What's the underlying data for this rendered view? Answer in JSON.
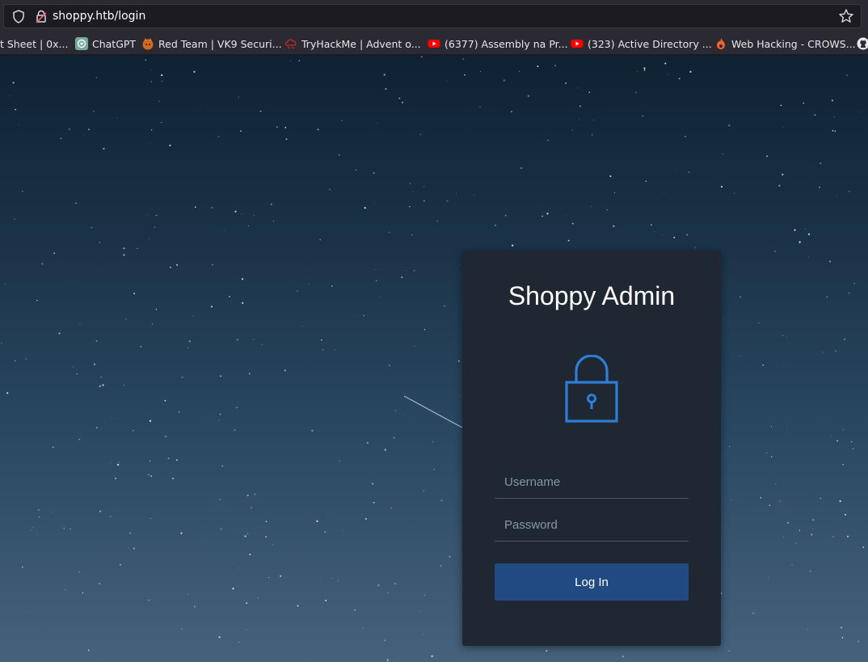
{
  "browser": {
    "url": "shoppy.htb/login",
    "bookmarks": [
      {
        "label": "t Sheet | 0x...",
        "icon": "none"
      },
      {
        "label": "ChatGPT",
        "icon": "chatgpt-icon"
      },
      {
        "label": "Red Team | VK9 Securi...",
        "icon": "vk9-icon"
      },
      {
        "label": "TryHackMe | Advent o...",
        "icon": "tryhackme-icon"
      },
      {
        "label": "(6377) Assembly na Pr...",
        "icon": "youtube-icon"
      },
      {
        "label": "(323) Active Directory ...",
        "icon": "youtube-icon"
      },
      {
        "label": "Web Hacking - CROWS...",
        "icon": "flame-icon"
      }
    ]
  },
  "login": {
    "title": "Shoppy Admin",
    "username_placeholder": "Username",
    "password_placeholder": "Password",
    "button_label": "Log In"
  },
  "colors": {
    "card_bg": "#1f2733",
    "accent": "#2e7ed8",
    "button_bg": "#224a82"
  }
}
